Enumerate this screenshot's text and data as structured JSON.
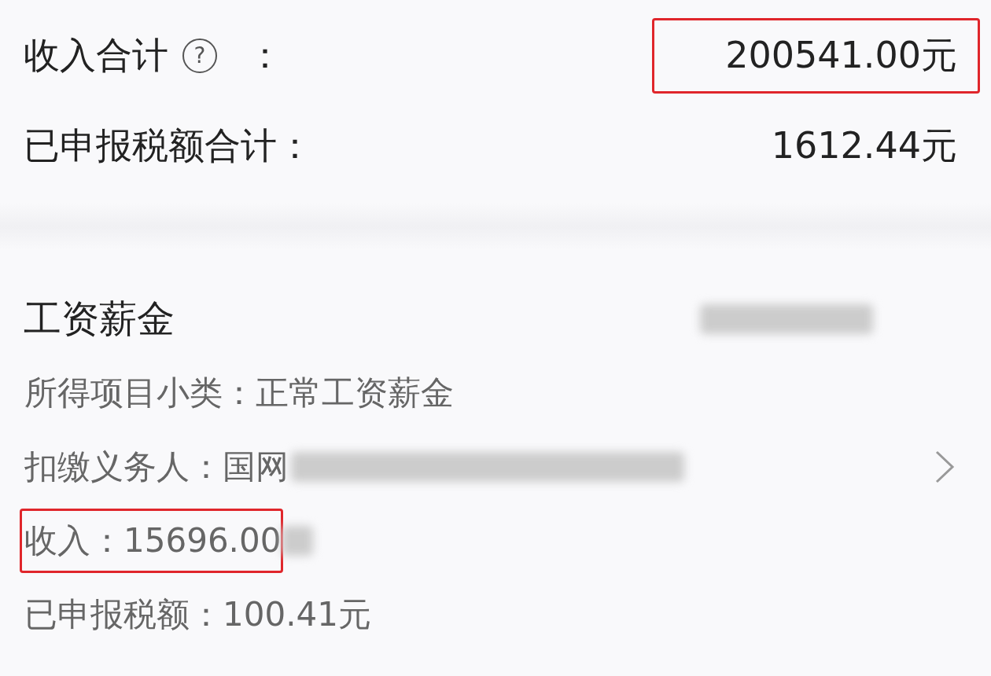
{
  "summary": [
    {
      "label": "收入合计",
      "help": "?",
      "colon": "：",
      "value": "200541.00元",
      "highlighted": true
    },
    {
      "label": "已申报税额合计：",
      "value": "1612.44元",
      "highlighted": false
    }
  ],
  "section": {
    "title": "工资薪金",
    "title_redacted": true,
    "details": [
      {
        "text": "所得项目小类：正常工资薪金",
        "redacted": false,
        "chevron": false,
        "highlighted": false
      },
      {
        "text": "扣缴义务人：国网",
        "redacted": true,
        "chevron": true,
        "highlighted": false
      },
      {
        "text": "收入：15696.00",
        "redacted": true,
        "chevron": false,
        "highlighted": true
      },
      {
        "text": "已申报税额：100.41元",
        "redacted": false,
        "chevron": false,
        "highlighted": false
      }
    ]
  }
}
